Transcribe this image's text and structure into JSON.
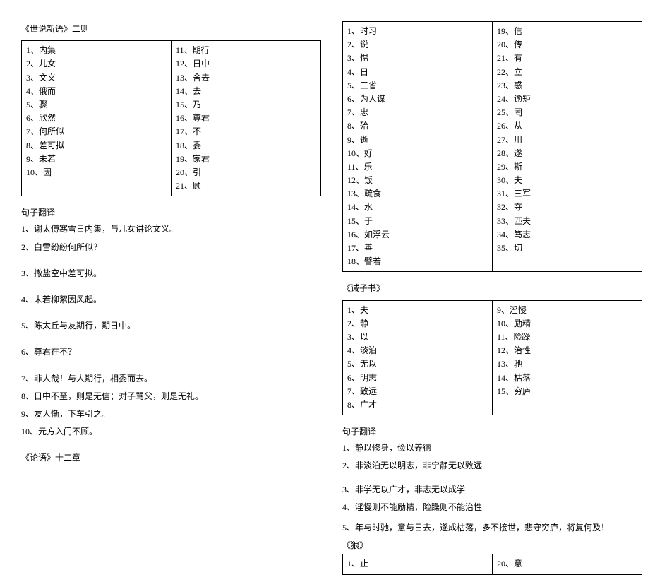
{
  "left": {
    "section1_title": "《世说新语》二则",
    "section1_vocab_col1": [
      "1、内集",
      "2、儿女",
      "3、文义",
      "4、俄而",
      "5、骤",
      "6、欣然",
      "7、何所似",
      "8、差可拟",
      "9、未若",
      "10、因"
    ],
    "section1_vocab_col2": [
      "11、期行",
      "12、日中",
      "13、舍去",
      "14、去",
      "15、乃",
      "16、尊君",
      "17、不",
      "18、委",
      "19、家君",
      "20、引",
      "21、顾"
    ],
    "sentence_header": "句子翻译",
    "sentences": [
      "1、谢太傅寒雪日内集，与儿女讲论文义。",
      "2、白雪纷纷何所似？",
      "3、撒盐空中差可拟。",
      "4、未若柳絮因风起。",
      "5、陈太丘与友期行，期日中。",
      "6、尊君在不？",
      "7、非人哉！与人期行，相委而去。",
      "8、日中不至，则是无信；对子骂父，则是无礼。",
      "9、友人惭，下车引之。",
      "10、元方入门不顾。"
    ],
    "section2_title": "《论语》十二章"
  },
  "right": {
    "lunyu_vocab_col1": [
      "1、时习",
      "2、说",
      "3、愠",
      "4、日",
      "5、三省",
      "6、为人谋",
      "7、忠",
      "8、殆",
      "9、逝",
      "10、好",
      "11、乐",
      "12、饭",
      "13、疏食",
      "14、水",
      "15、于",
      "16、如浮云",
      "17、善",
      "18、譬若"
    ],
    "lunyu_vocab_col2": [
      "19、信",
      "20、传",
      "21、有",
      "22、立",
      "23、惑",
      "24、逾矩",
      "25、罔",
      "26、从",
      "27、川",
      "28、遂",
      "29、斯",
      "30、夫",
      "31、三军",
      "32、夺",
      "33、匹夫",
      "34、笃志",
      "35、切"
    ],
    "jiezi_title": "《诫子书》",
    "jiezi_vocab_col1": [
      "1、夫",
      "2、静",
      "3、以",
      "4、淡泊",
      "5、无以",
      "6、明志",
      "7、致远",
      "8、广才"
    ],
    "jiezi_vocab_col2": [
      "9、淫慢",
      "10、励精",
      "11、险躁",
      "12、治性",
      "13、驰",
      "14、枯落",
      "15、穷庐"
    ],
    "sentence_header": "句子翻译",
    "jiezi_sentences": [
      "1、静以修身，俭以养德",
      "2、非淡泊无以明志，非宁静无以致远",
      "3、非学无以广才，非志无以成学",
      "4、淫慢则不能励精，险躁则不能治性",
      "5、年与时驰，意与日去，遂成枯落，多不接世，悲守穷庐，将复何及！"
    ],
    "lang_title": "《狼》",
    "lang_vocab_col1": [
      "1、止"
    ],
    "lang_vocab_col2": [
      "20、意"
    ]
  }
}
